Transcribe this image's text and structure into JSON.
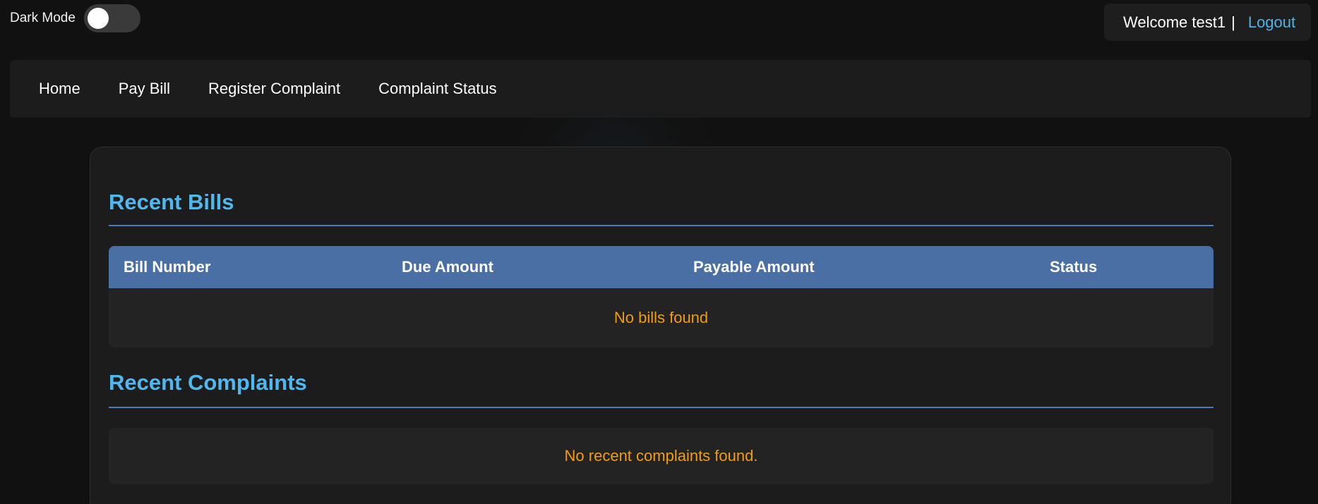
{
  "header": {
    "dark_mode_label": "Dark Mode",
    "dark_mode_on": false,
    "welcome": "Welcome test1",
    "separator": "|",
    "logout": "Logout"
  },
  "nav": {
    "items": [
      {
        "label": "Home"
      },
      {
        "label": "Pay Bill"
      },
      {
        "label": "Register Complaint"
      },
      {
        "label": "Complaint Status"
      }
    ]
  },
  "bills": {
    "title": "Recent Bills",
    "columns": [
      "Bill Number",
      "Due Amount",
      "Payable Amount",
      "Status"
    ],
    "empty_message": "No bills found"
  },
  "complaints": {
    "title": "Recent Complaints",
    "empty_message": "No recent complaints found."
  },
  "colors": {
    "accent": "#4fb8ee",
    "table_header": "#4a6fa5",
    "empty_text": "#f39c12"
  }
}
